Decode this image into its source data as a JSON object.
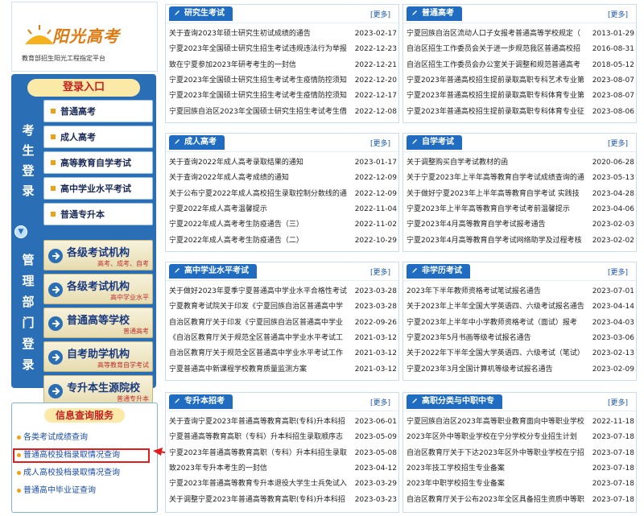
{
  "logo": {
    "title": "阳光高考",
    "subtitle": "教育部招生阳光工程指定平台"
  },
  "login": {
    "title": "登录入口",
    "vertical_label": [
      "考",
      "生",
      "登",
      "录"
    ],
    "items": [
      "普通高考",
      "成人高考",
      "高等教育自学考试",
      "高中学业水平考试",
      "普通专升本"
    ]
  },
  "management": {
    "vertical_label": [
      "管",
      "理",
      "部",
      "门",
      "登",
      "录"
    ],
    "items": [
      {
        "title": "各级考试机构",
        "sub": "高考、成考、自考"
      },
      {
        "title": "各级考试机构",
        "sub": "高中学业水平"
      },
      {
        "title": "普通高等学校",
        "sub": "普通高考"
      },
      {
        "title": "自考助学机构",
        "sub": "高等教育自学考试"
      },
      {
        "title": "专升本生源院校",
        "sub": "普通专升本"
      }
    ]
  },
  "info_query": {
    "title": "信息查询服务",
    "items": [
      "各类考试成绩查询",
      "普通高校投档录取情况查询",
      "成人高校投档录取情况查询",
      "普通高中毕业证查询"
    ]
  },
  "more_label": "[更多]",
  "panels": [
    {
      "name": "研究生考试",
      "rows": [
        {
          "t": "关于查询2023年硕士研究生初试成绩的通告",
          "d": "2023-02-17"
        },
        {
          "t": "宁夏2023年全国硕士研究生招生考试违规违法行为举报",
          "d": "2022-12-23"
        },
        {
          "t": "致在宁夏参加2023年研考考生的一封信",
          "d": "2022-12-21"
        },
        {
          "t": "宁夏2023年全国硕士研究生招生考试考生疫情防控须知",
          "d": "2022-12-20"
        },
        {
          "t": "宁夏2023年全国硕士研究生招生考试考生疫情防控须知",
          "d": "2022-12-17"
        },
        {
          "t": "宁夏回族自治区2023年全国硕士研究生招生考试考生借",
          "d": "2022-12-08"
        }
      ]
    },
    {
      "name": "普通高考",
      "rows": [
        {
          "t": "宁夏回族自治区流动人口子女报考普通高等学校规定（",
          "d": "2013-01-29"
        },
        {
          "t": "自治区招生工作委员会关于进一步规范我区普通高校招",
          "d": "2016-08-31"
        },
        {
          "t": "自治区招生工作委员会办公室关于调整和规范普通高考",
          "d": "2018-05-12"
        },
        {
          "t": "宁夏2023年普通高校招生提前录取高职专科艺术专业第",
          "d": "2023-08-07"
        },
        {
          "t": "宁夏2023年普通高校招生提前录取高职专科体育专业第",
          "d": "2023-08-07"
        },
        {
          "t": "宁夏2023年普通高校招生提前录取高职专科体育专业征",
          "d": "2023-08-06"
        }
      ]
    },
    {
      "name": "成人高考",
      "rows": [
        {
          "t": "关于查询2022年成人高考录取结果的通知",
          "d": "2023-01-17"
        },
        {
          "t": "关于查询2022年成人高考成绩的通知",
          "d": "2022-12-09"
        },
        {
          "t": "关于公布宁夏2022年成人高校招生录取控制分数线的通",
          "d": "2022-12-09"
        },
        {
          "t": "宁夏2022年成人高考温馨提示",
          "d": "2022-11-04"
        },
        {
          "t": "宁夏2022年成人高考考生防疫通告（三）",
          "d": "2022-11-02"
        },
        {
          "t": "宁夏2022年成人高考考生防疫通告（二）",
          "d": "2022-10-29"
        }
      ]
    },
    {
      "name": "自学考试",
      "rows": [
        {
          "t": "关于调整购买自学考试教材的函",
          "d": "2020-06-28"
        },
        {
          "t": "关于宁夏2023年上半年高等教育自学考试成绩查询的通",
          "d": "2023-05-13"
        },
        {
          "t": "关于做好宁夏2023年上半年高等教育自学考试 实践技",
          "d": "2023-04-28"
        },
        {
          "t": "宁夏2023年上半年高等教育自学考试考前温馨提示",
          "d": "2023-04-06"
        },
        {
          "t": "宁夏2023年4月高等教育自学考试报考通告",
          "d": "2023-02-03"
        },
        {
          "t": "宁夏2023年4月高等教育自学考试网络助学及过程考核",
          "d": "2023-02-02"
        }
      ]
    },
    {
      "name": "高中学业水平考试",
      "rows": [
        {
          "t": "关于做好2023年夏季宁夏普通高中学业水平合格性考试",
          "d": "2023-03-28"
        },
        {
          "t": "宁夏教育考试院关于印发《宁夏回族自治区普通高中学",
          "d": "2023-03-28"
        },
        {
          "t": "自治区教育厅关于印发《宁夏回族自治区普通高中学业",
          "d": "2022-09-26"
        },
        {
          "t": "《自治区教育厅关于规范全区普通高中学业水平考试工",
          "d": "2021-03-12"
        },
        {
          "t": "自治区教育厅关于规范全区普通高中学业水平考试工作",
          "d": "2021-03-12"
        },
        {
          "t": "宁夏普通高中新课程学校教育质量监测方案",
          "d": "2021-03-12"
        }
      ]
    },
    {
      "name": "非学历考试",
      "rows": [
        {
          "t": "2023年下半年教师资格考试笔试报名通告",
          "d": "2023-07-01"
        },
        {
          "t": "关于2023年上半年全国大学英语四、六级考试报名通告",
          "d": "2023-04-14"
        },
        {
          "t": "宁夏2023年上半年中小学教师资格考试（面试）报考",
          "d": "2023-04-03"
        },
        {
          "t": "宁夏2023年5月书画等级考试报名通告",
          "d": "2023-03-06"
        },
        {
          "t": "关于2022年下半年全国大学英语四、六级考试（笔试）",
          "d": "2023-02-13"
        },
        {
          "t": "宁夏2023年3月全国计算机等级考试报名通告",
          "d": "2023-02-09"
        }
      ]
    },
    {
      "name": "专升本招考",
      "rows": [
        {
          "t": "关于查询宁夏2023年普通高等教育高职(专科)升本科招",
          "d": "2023-06-01"
        },
        {
          "t": "宁夏普通高等教育高职（专科）升本科招生录取顺序志",
          "d": "2023-05-09"
        },
        {
          "t": "宁夏2023年普通高等教育高职（专科）升本科招生录取",
          "d": "2023-05-08"
        },
        {
          "t": "致2023年专升本考生的一封信",
          "d": "2023-04-12"
        },
        {
          "t": "宁夏2023年普通高等教育专升本退役大学生士兵免试入",
          "d": "2023-03-29"
        },
        {
          "t": "关于调整宁夏2023年普通高等教育高职(专科)升本科招",
          "d": "2023-03-23"
        }
      ]
    },
    {
      "name": "高职分类与中职中专",
      "rows": [
        {
          "t": "宁夏回族自治区2023年高等职业教育面向中等职业学校",
          "d": "2022-11-18"
        },
        {
          "t": "2023年区外中等职业学校在宁分学校分专业招生计划",
          "d": "2023-07-18"
        },
        {
          "t": "自治区教育厅关于下达2023年区外中等职业学校在宁招",
          "d": "2023-07-18"
        },
        {
          "t": "2023年技工学校招生专业备案",
          "d": "2023-07-18"
        },
        {
          "t": "2023年中职学校招生专业备案",
          "d": "2023-07-18"
        },
        {
          "t": "自治区教育厅关于公布2023年全区具备招生资质中等职",
          "d": "2023-07-18"
        }
      ]
    }
  ],
  "colors": {
    "tab_blue": "#1f6cc0",
    "login_blue": "#2a6fb6",
    "highlight_red": "#e21b1b",
    "accent_orange": "#f2a010"
  }
}
